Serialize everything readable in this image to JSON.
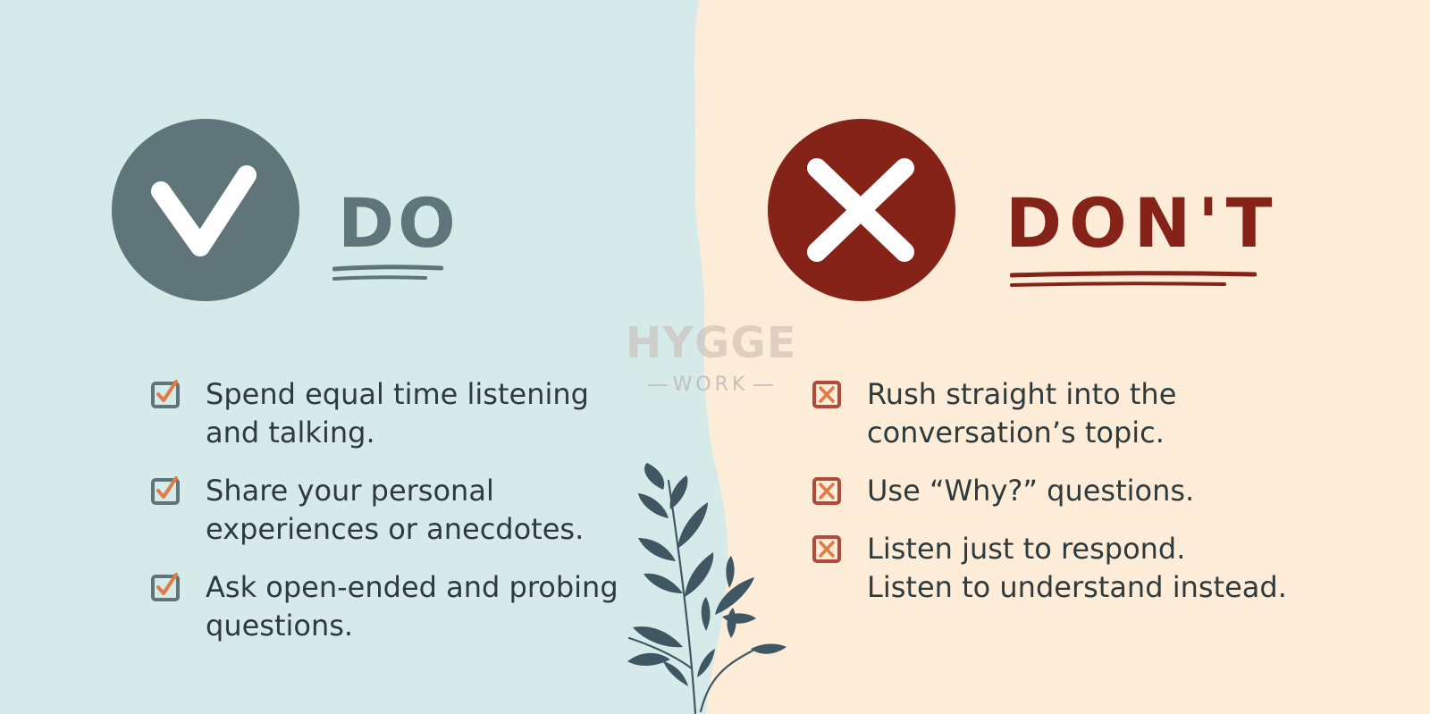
{
  "colors": {
    "left_bg": "#d6eaea",
    "right_bg": "#fdecd8",
    "do_color": "#5f757a",
    "dont_color": "#852319",
    "check_accent": "#e17b45",
    "leaf_color": "#3e5763"
  },
  "do_section": {
    "icon": "checkmark-icon",
    "heading": "DO",
    "items": [
      {
        "line1": "Spend equal time listening",
        "line2": "and talking."
      },
      {
        "line1": "Share your personal",
        "line2": "experiences or anecdotes."
      },
      {
        "line1": "Ask open-ended and probing",
        "line2": "questions."
      }
    ]
  },
  "dont_section": {
    "icon": "x-mark-icon",
    "heading": "DON'T",
    "items": [
      {
        "line1": "Rush straight into the",
        "line2": "conversation’s topic."
      },
      {
        "line1": "Use “Why?” questions.",
        "line2": ""
      },
      {
        "line1": "Listen just to respond.",
        "line2": "Listen to understand instead."
      }
    ]
  },
  "watermark": {
    "brand": "HYGGE",
    "sub": "WORK"
  }
}
